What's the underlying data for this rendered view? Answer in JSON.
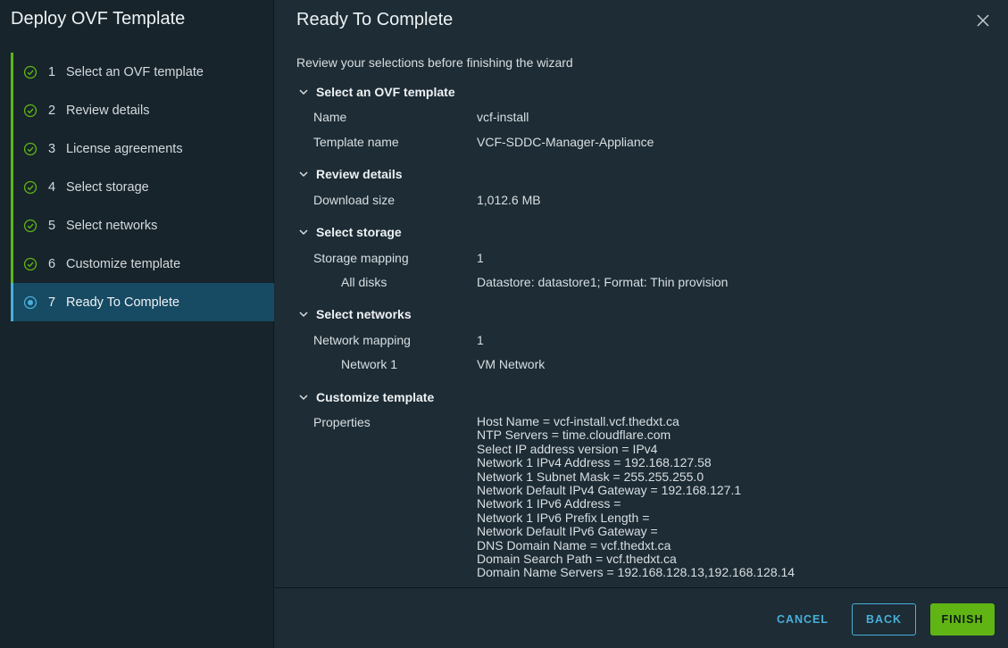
{
  "sidebar": {
    "title": "Deploy OVF Template",
    "steps": [
      {
        "num": "1",
        "label": "Select an OVF template"
      },
      {
        "num": "2",
        "label": "Review details"
      },
      {
        "num": "3",
        "label": "License agreements"
      },
      {
        "num": "4",
        "label": "Select storage"
      },
      {
        "num": "5",
        "label": "Select networks"
      },
      {
        "num": "6",
        "label": "Customize template"
      },
      {
        "num": "7",
        "label": "Ready To Complete"
      }
    ]
  },
  "main": {
    "title": "Ready To Complete",
    "intro": "Review your selections before finishing the wizard",
    "sections": {
      "ovf": {
        "title": "Select an OVF template",
        "name_label": "Name",
        "name_value": "vcf-install",
        "template_label": "Template name",
        "template_value": "VCF-SDDC-Manager-Appliance"
      },
      "review": {
        "title": "Review details",
        "download_label": "Download size",
        "download_value": "1,012.6 MB"
      },
      "storage": {
        "title": "Select storage",
        "mapping_label": "Storage mapping",
        "mapping_value": "1",
        "disks_label": "All disks",
        "disks_value": "Datastore: datastore1; Format: Thin provision"
      },
      "networks": {
        "title": "Select networks",
        "mapping_label": "Network mapping",
        "mapping_value": "1",
        "net1_label": "Network 1",
        "net1_value": "VM Network"
      },
      "customize": {
        "title": "Customize template",
        "properties_label": "Properties",
        "properties": [
          "Host Name = vcf-install.vcf.thedxt.ca",
          "NTP Servers = time.cloudflare.com",
          "Select IP address version = IPv4",
          "Network 1 IPv4 Address = 192.168.127.58",
          "Network 1 Subnet Mask = 255.255.255.0",
          "Network Default IPv4 Gateway = 192.168.127.1",
          "Network 1 IPv6 Address =",
          "Network 1 IPv6 Prefix Length =",
          "Network Default IPv6 Gateway =",
          "DNS Domain Name = vcf.thedxt.ca",
          "Domain Search Path = vcf.thedxt.ca",
          "Domain Name Servers = 192.168.128.13,192.168.128.14"
        ]
      }
    }
  },
  "footer": {
    "cancel_label": "CANCEL",
    "back_label": "BACK",
    "finish_label": "FINISH"
  },
  "colors": {
    "accent_green": "#60b515",
    "accent_blue": "#49afd9",
    "active_step_bg": "#174a63"
  },
  "icons": {
    "completed_step": "check-circle-icon",
    "current_step": "dot-circle-icon",
    "section_toggle": "chevron-down-icon",
    "close": "close-icon"
  }
}
